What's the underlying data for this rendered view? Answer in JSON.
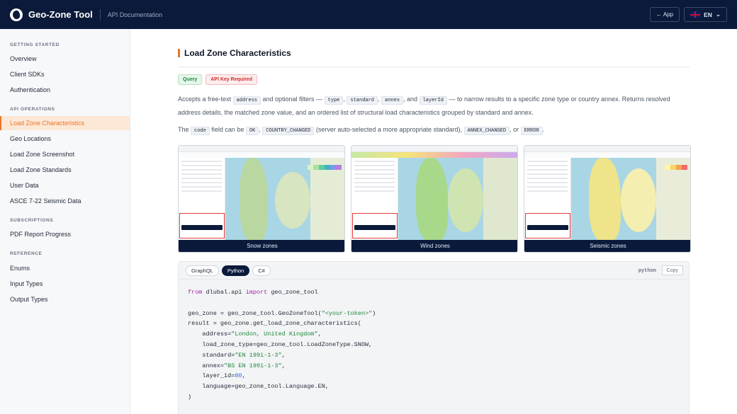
{
  "header": {
    "brand": "Geo-Zone Tool",
    "subtitle": "API Documentation",
    "app_button": "← App",
    "lang_button": "EN",
    "lang_chevron": "⌄"
  },
  "sidebar": {
    "sections": [
      {
        "title": "GETTING STARTED",
        "items": [
          "Overview",
          "Client SDKs",
          "Authentication"
        ]
      },
      {
        "title": "API OPERATIONS",
        "items": [
          "Load Zone Characteristics",
          "Geo Locations",
          "Load Zone Screenshot",
          "Load Zone Standards",
          "User Data",
          "ASCE 7-22 Seismic Data"
        ]
      },
      {
        "title": "SUBSCRIPTIONS",
        "items": [
          "PDF Report Progress"
        ]
      },
      {
        "title": "REFERENCE",
        "items": [
          "Enums",
          "Input Types",
          "Output Types"
        ]
      }
    ],
    "active_item": "Load Zone Characteristics"
  },
  "main": {
    "title": "Load Zone Characteristics",
    "badges": [
      "Query",
      "API Key Required"
    ],
    "paragraph1": {
      "t1": "Accepts a free-text",
      "c1": "address",
      "t2": "and optional filters —",
      "c2": "type",
      "t3": ",",
      "c3": "standard",
      "t4": ",",
      "c4": "annex",
      "t5": ", and",
      "c5": "layerId",
      "t6": "— to narrow results to a specific zone type or country annex.",
      "t7": "Returns resolved address details, the matched zone value, and an ordered list of structural load characteristics grouped by standard and annex."
    },
    "paragraph2": {
      "t1": "The",
      "c1": "code",
      "t2": "field can be",
      "c2": "OK",
      "t3": ",",
      "c3": "COUNTRY_CHANGED",
      "t4": "(server auto-selected a more appropriate standard),",
      "c4": "ANNEX_CHANGED",
      "t5": ", or",
      "c5": "ERROR",
      "t6": "."
    },
    "screenshots": [
      {
        "label": "Snow zones"
      },
      {
        "label": "Wind zones"
      },
      {
        "label": "Seismic zones"
      }
    ],
    "code": {
      "tabs": [
        "GraphQL",
        "Python",
        "C#"
      ],
      "active_tab": "Python",
      "language": "python",
      "copy_label": "Copy",
      "lines": [
        "from dlubal.api import geo_zone_tool",
        "",
        "geo_zone = geo_zone_tool.GeoZoneTool(\"<your-token>\")",
        "result = geo_zone.get_load_zone_characteristics(",
        "    address=\"London, United Kingdom\",",
        "    load_zone_type=geo_zone_tool.LoadZoneType.SNOW,",
        "    standard=\"EN 1991-1-3\",",
        "    annex=\"BS EN 1991-1-3\",",
        "    layer_id=80,",
        "    language=geo_zone_tool.Language.EN,",
        ")"
      ]
    }
  },
  "colors": {
    "navy": "#0b1a3a",
    "accent": "#e8762b",
    "query_green": "#1b8a3c",
    "apikey_red": "#cf2f2f"
  }
}
